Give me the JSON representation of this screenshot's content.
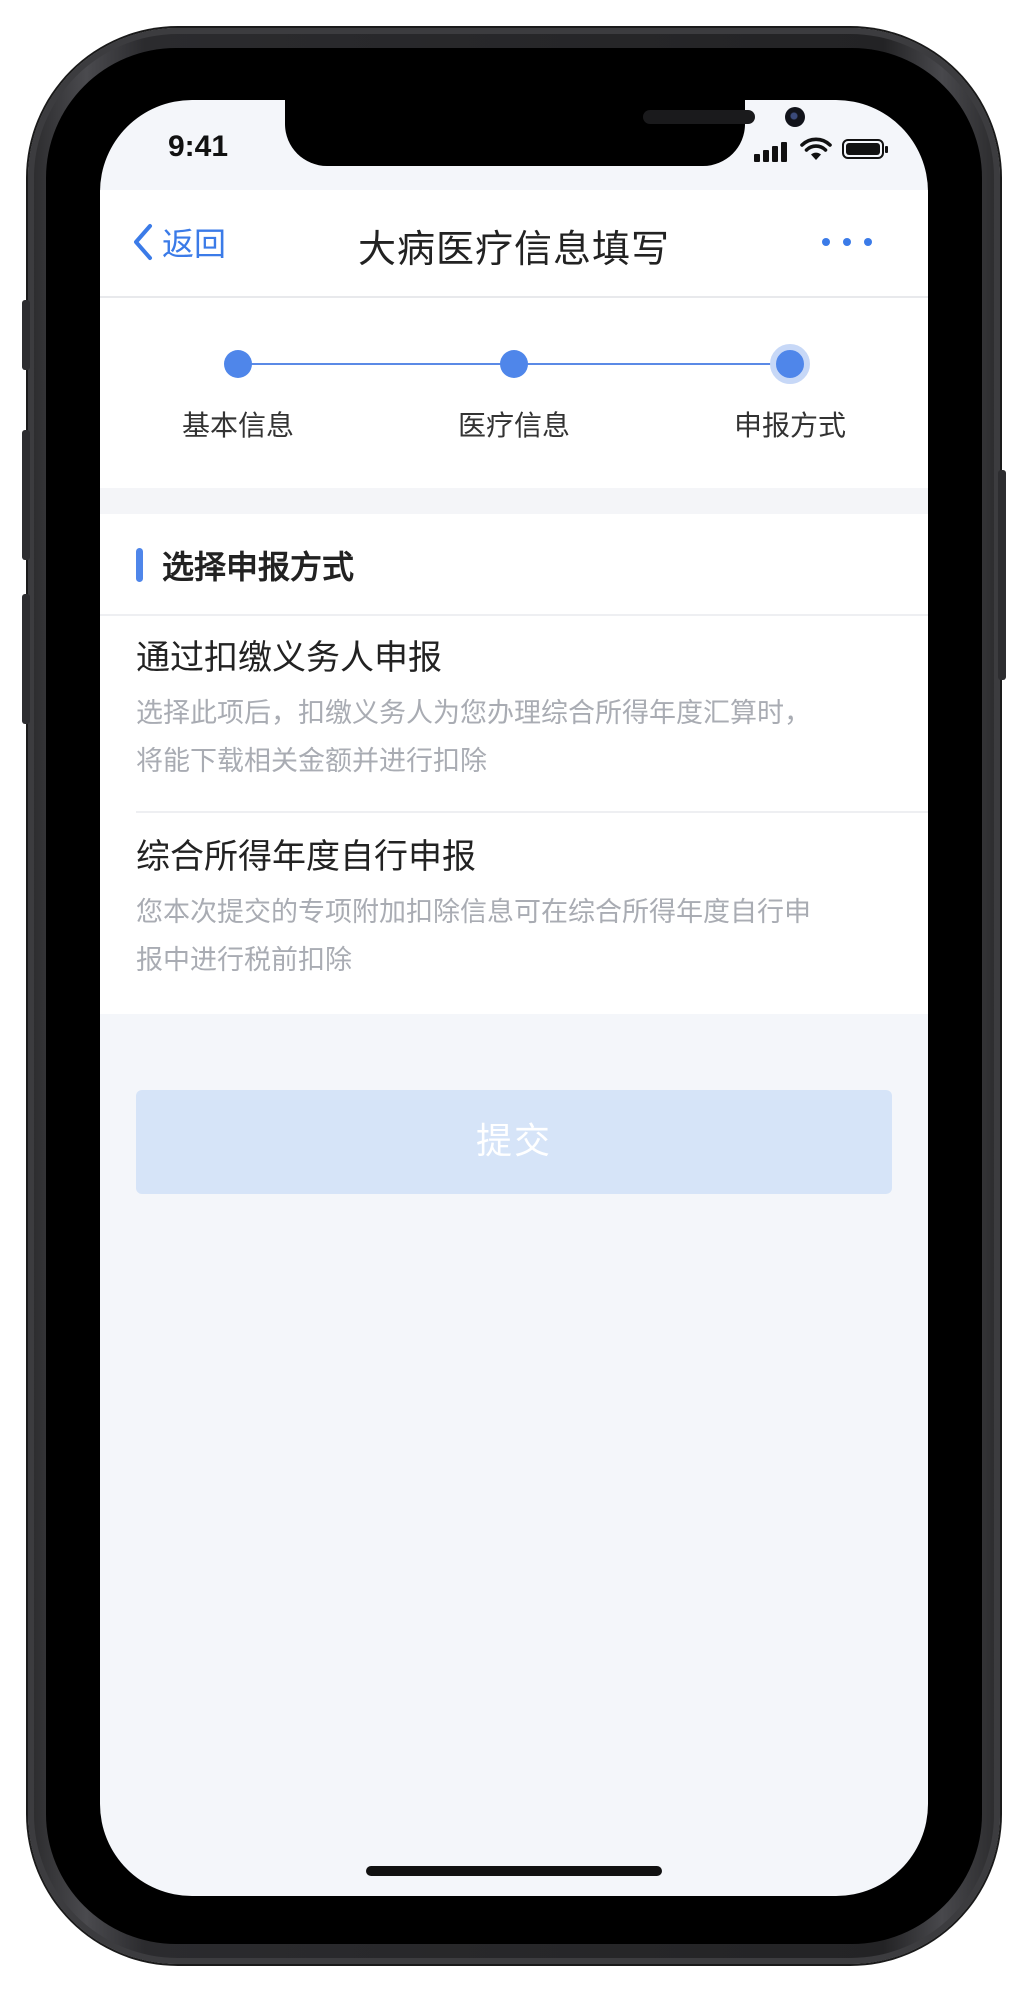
{
  "status_bar": {
    "time": "9:41"
  },
  "nav": {
    "back_label": "返回",
    "title": "大病医疗信息填写"
  },
  "stepper": {
    "steps": [
      {
        "label": "基本信息",
        "state": "done"
      },
      {
        "label": "医疗信息",
        "state": "done"
      },
      {
        "label": "申报方式",
        "state": "current"
      }
    ]
  },
  "section": {
    "title": "选择申报方式",
    "options": [
      {
        "title": "通过扣缴义务人申报",
        "description": "选择此项后，扣缴义务人为您办理综合所得年度汇算时，将能下载相关金额并进行扣除"
      },
      {
        "title": "综合所得年度自行申报",
        "description": "您本次提交的专项附加扣除信息可在综合所得年度自行申报中进行税前扣除"
      }
    ]
  },
  "submit": {
    "label": "提交",
    "enabled": false
  },
  "colors": {
    "accent": "#4f86ea",
    "link": "#3b7be8",
    "submit_disabled_bg": "#d6e4f8",
    "page_bg": "#f4f6fa"
  }
}
